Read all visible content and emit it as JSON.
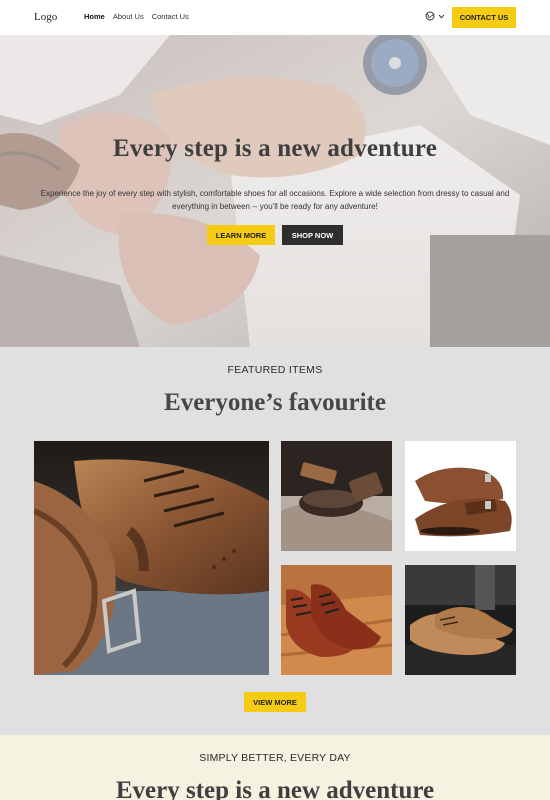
{
  "nav": {
    "logo": "Logo",
    "links": [
      "Home",
      "About Us",
      "Contact Us"
    ],
    "contact_button": "CONTACT US",
    "language_icon": "globe-icon",
    "dropdown_icon": "chevron-down-icon"
  },
  "hero": {
    "title": "Every step is a new adventure",
    "text": "Experience the joy of every step with stylish, comfortable shoes for all occasions. Explore a wide selection from dressy to casual and everything in between -- you'll be ready for any adventure!",
    "learn_more": "LEARN MORE",
    "shop_now": "SHOP NOW"
  },
  "featured": {
    "label": "FEATURED ITEMS",
    "title": "Everyone’s favourite",
    "view_more": "VIEW MORE"
  },
  "bottom": {
    "label": "SIMPLY BETTER, EVERY DAY",
    "title": "Every step is a new adventure"
  },
  "colors": {
    "accent": "#f5cb13",
    "dark_button": "#2e2e2e",
    "featured_bg": "#e0e0e0",
    "bottom_bg": "#f5f2e1"
  }
}
